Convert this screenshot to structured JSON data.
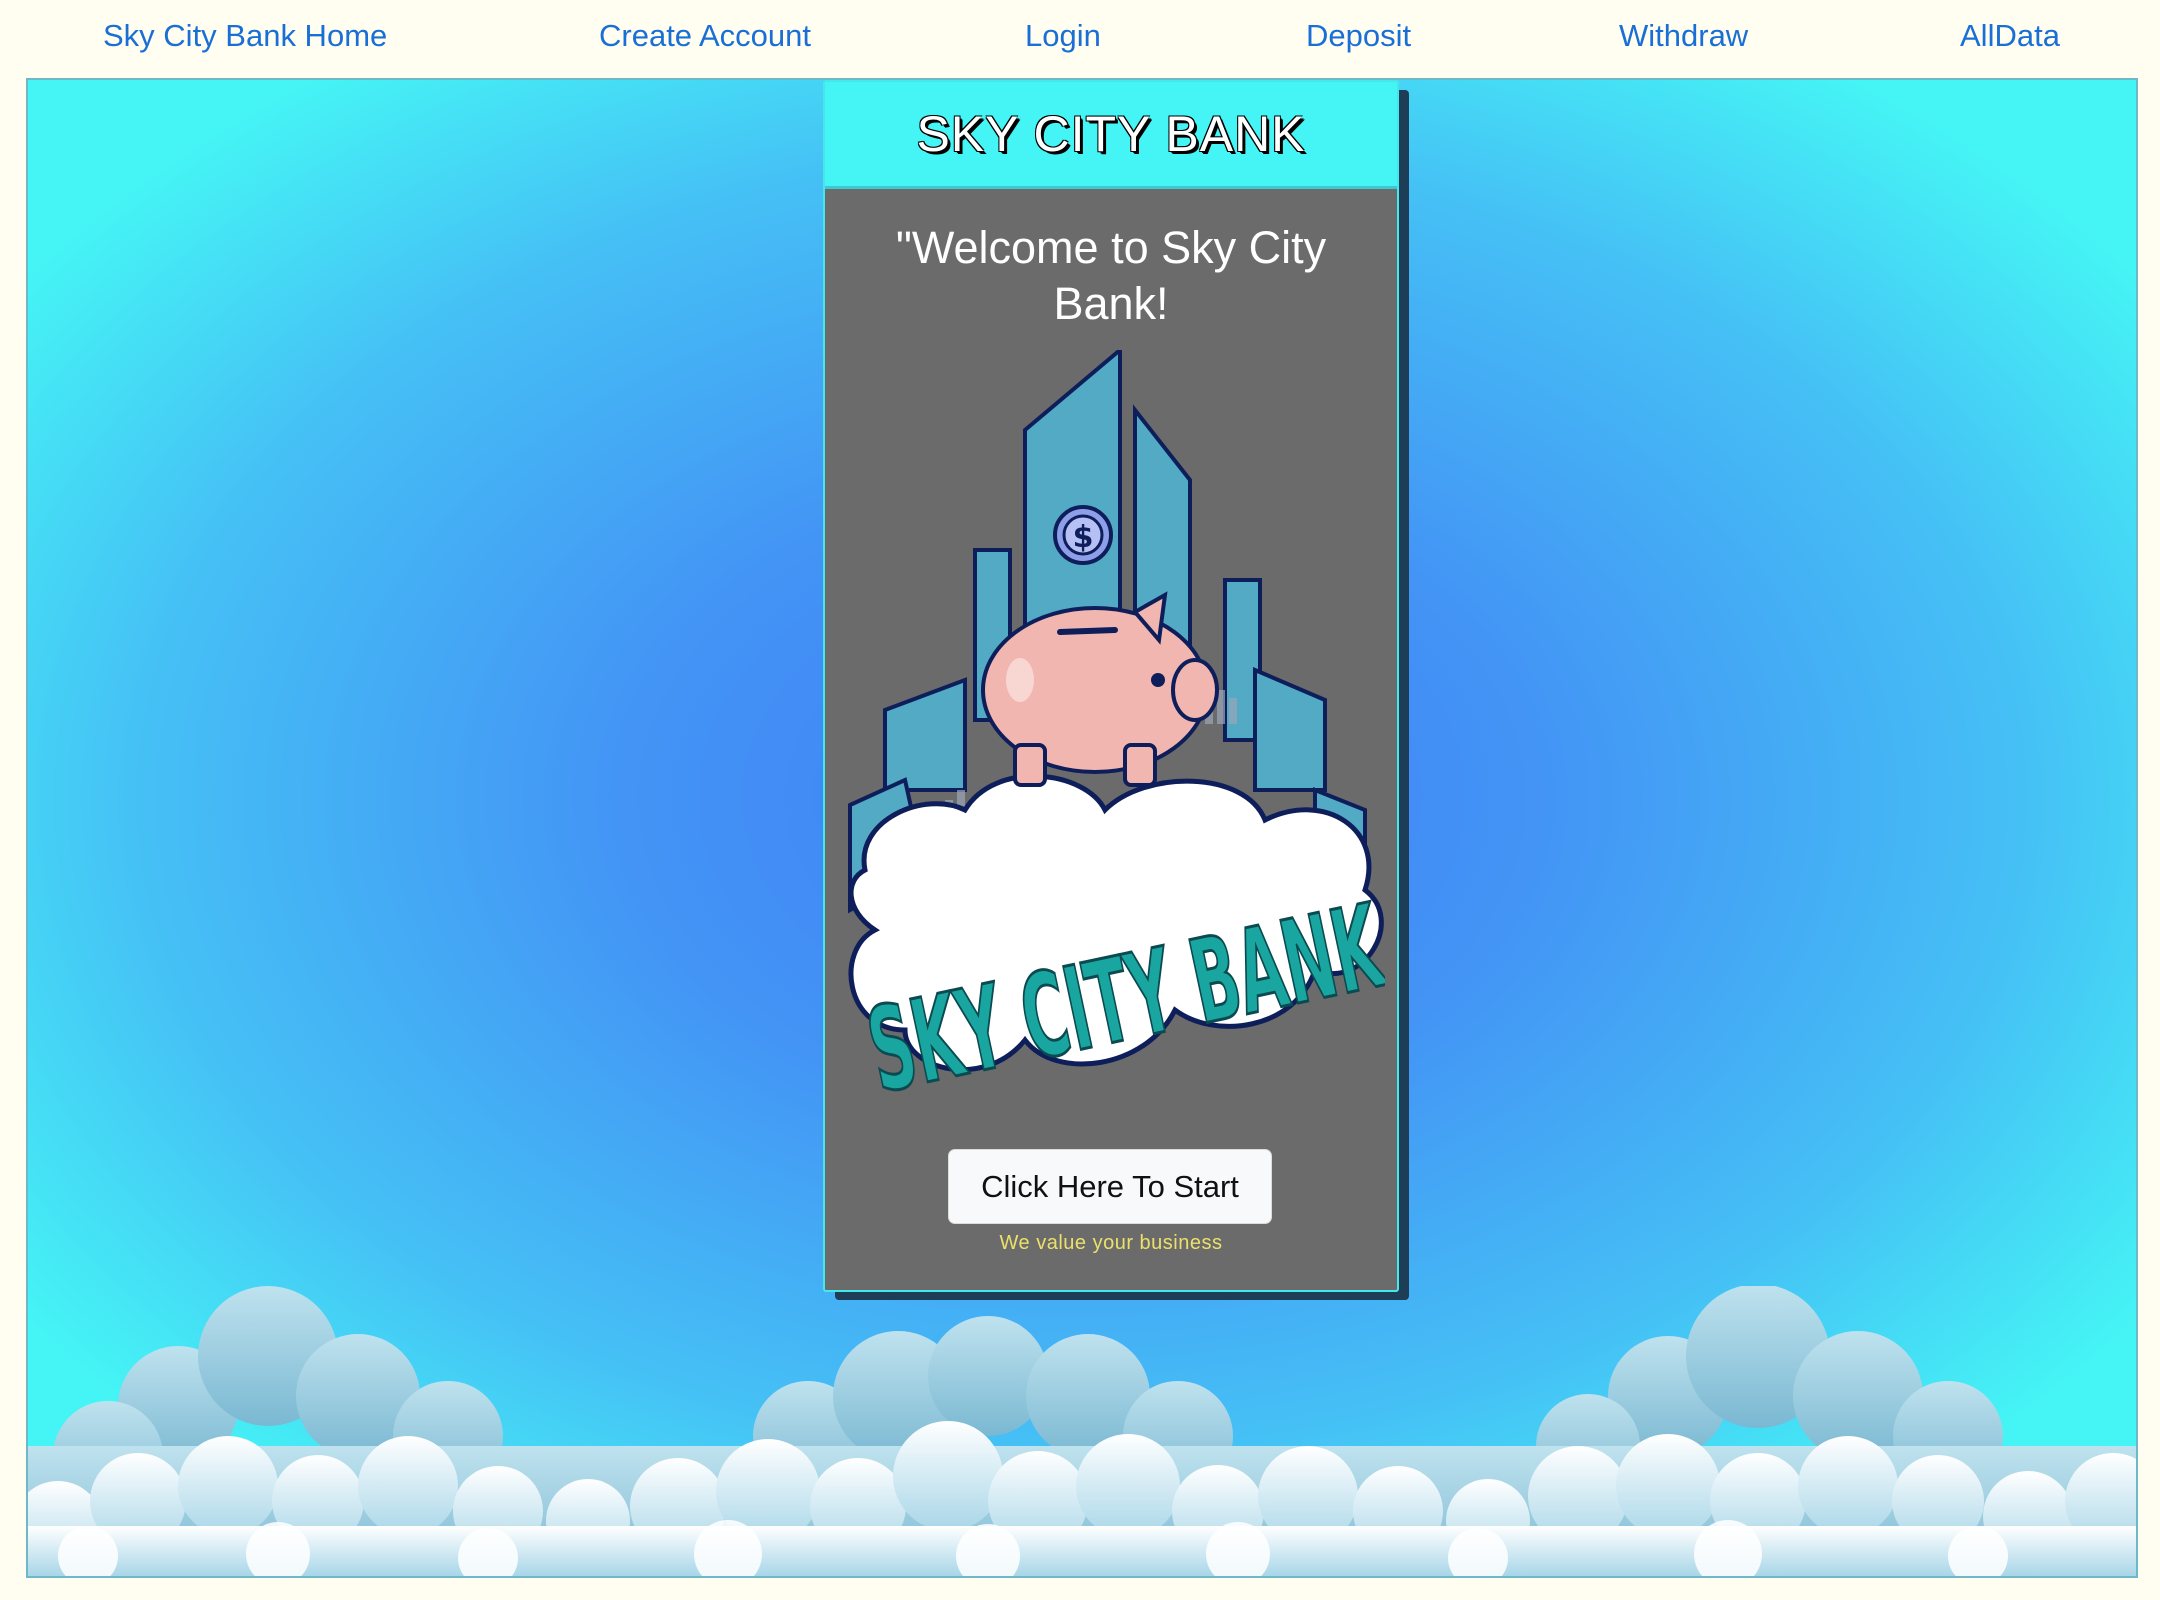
{
  "nav": {
    "home": "Sky City Bank Home",
    "create_account": "Create Account",
    "login": "Login",
    "deposit": "Deposit",
    "withdraw": "Withdraw",
    "alldata": "AllData"
  },
  "card": {
    "header_title": "SKY CITY BANK",
    "welcome_text": "\"Welcome to Sky City Bank!",
    "logo_text": "SKY CITY BANK",
    "logo_coin_symbol": "$",
    "start_button": "Click Here To Start",
    "tagline": "We value your business"
  },
  "colors": {
    "nav_link": "#1a6fd6",
    "background_center": "#3f7ff8",
    "background_edge": "#45f5f5",
    "card_body": "#6b6b6b",
    "card_header": "#45f5f5",
    "tagline": "#ece06a"
  }
}
